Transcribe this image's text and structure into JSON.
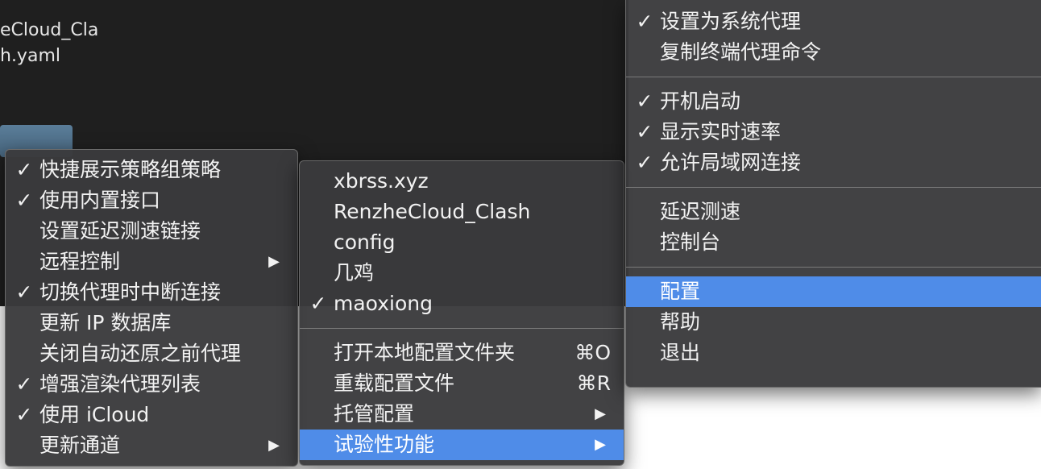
{
  "finder": {
    "file_line_1": "eCloud_Cla",
    "file_line_2": "h.yaml"
  },
  "left_menu": {
    "items": [
      {
        "label": "快捷展示策略组策略",
        "checked": "✓",
        "arrow": ""
      },
      {
        "label": "使用内置接口",
        "checked": "✓",
        "arrow": ""
      },
      {
        "label": "设置延迟测速链接",
        "checked": "",
        "arrow": ""
      },
      {
        "label": "远程控制",
        "checked": "",
        "arrow": "▶"
      },
      {
        "label": "切换代理时中断连接",
        "checked": "✓",
        "arrow": ""
      },
      {
        "label": "更新 IP 数据库",
        "checked": "",
        "arrow": ""
      },
      {
        "label": "关闭自动还原之前代理",
        "checked": "",
        "arrow": ""
      },
      {
        "label": "增强渲染代理列表",
        "checked": "✓",
        "arrow": ""
      },
      {
        "label": "使用 iCloud",
        "checked": "✓",
        "arrow": ""
      },
      {
        "label": "更新通道",
        "checked": "",
        "arrow": "▶"
      }
    ]
  },
  "middle_menu": {
    "configs": [
      {
        "label": "xbrss.xyz",
        "checked": ""
      },
      {
        "label": "RenzheCloud_Clash",
        "checked": ""
      },
      {
        "label": "config",
        "checked": ""
      },
      {
        "label": "几鸡",
        "checked": ""
      },
      {
        "label": "maoxiong",
        "checked": "✓"
      }
    ],
    "actions": [
      {
        "label": "打开本地配置文件夹",
        "shortcut": "⌘O",
        "arrow": ""
      },
      {
        "label": "重载配置文件",
        "shortcut": "⌘R",
        "arrow": ""
      },
      {
        "label": "托管配置",
        "shortcut": "",
        "arrow": "▶"
      },
      {
        "label": "试验性功能",
        "shortcut": "",
        "arrow": "▶"
      }
    ]
  },
  "right_menu": {
    "group1": [
      {
        "label": "设置为系统代理",
        "checked": "✓"
      },
      {
        "label": "复制终端代理命令",
        "checked": ""
      }
    ],
    "group2": [
      {
        "label": "开机启动",
        "checked": "✓"
      },
      {
        "label": "显示实时速率",
        "checked": "✓"
      },
      {
        "label": "允许局域网连接",
        "checked": "✓"
      }
    ],
    "group3": [
      {
        "label": "延迟测速"
      },
      {
        "label": "控制台"
      }
    ],
    "group4": [
      {
        "label": "配置"
      },
      {
        "label": "帮助"
      },
      {
        "label": "退出"
      }
    ]
  },
  "colors": {
    "menu_bg": "#3a3a3c",
    "highlight": "#4f8ce8",
    "finder_bg": "#1f1f1f"
  }
}
